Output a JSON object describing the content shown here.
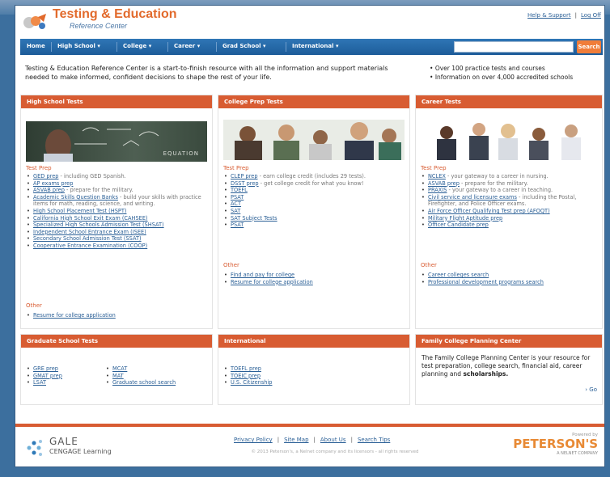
{
  "header": {
    "title": "Testing & Education",
    "subtitle": "Reference Center",
    "help_link": "Help & Support",
    "logoff_link": "Log Off"
  },
  "nav": {
    "items": [
      {
        "label": "Home"
      },
      {
        "label": "High School ▾"
      },
      {
        "label": "College ▾"
      },
      {
        "label": "Career ▾"
      },
      {
        "label": "Grad School ▾"
      },
      {
        "label": "International ▾"
      }
    ],
    "search_value": "",
    "search_button": "Search"
  },
  "intro": {
    "text": "Testing & Education Reference Center is a start-to-finish resource with all the information and support materials needed to make informed, confident decisions to shape the rest of your life.",
    "bullets": [
      "Over 100 practice tests and courses",
      "Information on over 4,000 accredited schools"
    ]
  },
  "panels": {
    "high_school": {
      "title": "High School Tests",
      "image_text": "EQUATION",
      "section1": "Test Prep",
      "items": [
        {
          "link": "GED prep",
          "desc": " - including GED Spanish."
        },
        {
          "link": "AP exams prep",
          "desc": ""
        },
        {
          "link": "ASVAB prep",
          "desc": " - prepare for the military."
        },
        {
          "link": "Academic Skills Question Banks",
          "desc": " - build your skills with practice items for math, reading, science, and writing."
        },
        {
          "link": "High School Placement Test (HSPT)",
          "desc": ""
        },
        {
          "link": "California High School Exit Exam (CAHSEE)",
          "desc": ""
        },
        {
          "link": "Specialized High Schools Admission Test (SHSAT)",
          "desc": ""
        },
        {
          "link": "Independent School Entrance Exam (ISEE)",
          "desc": ""
        },
        {
          "link": "Secondary School Admission Test (SSAT)",
          "desc": ""
        },
        {
          "link": "Cooperative Entrance Examination (COOP)",
          "desc": ""
        }
      ],
      "section2": "Other",
      "other": [
        {
          "link": "Resume for college application"
        }
      ]
    },
    "college": {
      "title": "College Prep Tests",
      "section1": "Test Prep",
      "items": [
        {
          "link": "CLEP prep",
          "desc": " - earn college credit (includes 29 tests)."
        },
        {
          "link": "DSST prep",
          "desc": " - get college credit for what you know!"
        },
        {
          "link": "TOEFL",
          "desc": ""
        },
        {
          "link": "PSAT",
          "desc": ""
        },
        {
          "link": "ACT",
          "desc": ""
        },
        {
          "link": "SAT",
          "desc": ""
        },
        {
          "link": "SAT Subject Tests",
          "desc": ""
        },
        {
          "link": "PSAT",
          "desc": ""
        }
      ],
      "section2": "Other",
      "other": [
        {
          "link": "Find and pay for college"
        },
        {
          "link": "Resume for college application"
        }
      ]
    },
    "career": {
      "title": "Career Tests",
      "section1": "Test Prep",
      "items": [
        {
          "link": "NCLEX",
          "desc": " - your gateway to a career in nursing."
        },
        {
          "link": "ASVAB prep",
          "desc": " - prepare for the military."
        },
        {
          "link": "PRAXIS",
          "desc": " - your gateway to a career in teaching."
        },
        {
          "link": "Civil service and licensure exams",
          "desc": " - including the Postal, Firefighter, and Police Officer exams."
        },
        {
          "link": "Air Force Officer Qualifying Test prep (AFOQT)",
          "desc": ""
        },
        {
          "link": "Military Flight Aptitude prep",
          "desc": ""
        },
        {
          "link": "Officer Candidate prep",
          "desc": ""
        }
      ],
      "section2": "Other",
      "other": [
        {
          "link": "Career colleges search"
        },
        {
          "link": "Professional development programs search"
        }
      ]
    },
    "graduate": {
      "title": "Graduate School Tests",
      "col1": [
        {
          "link": "GRE prep"
        },
        {
          "link": "GMAT prep"
        },
        {
          "link": "LSAT"
        }
      ],
      "col2": [
        {
          "link": "MCAT"
        },
        {
          "link": "MAT"
        },
        {
          "link": "Graduate school search"
        }
      ]
    },
    "international": {
      "title": "International",
      "items": [
        {
          "link": "TOEFL prep"
        },
        {
          "link": "TOEIC prep"
        },
        {
          "link": "U.S. Citizenship"
        }
      ]
    },
    "family": {
      "title": "Family College Planning Center",
      "text": "The Family College Planning Center is your resource for test preparation, college search, financial aid, career planning and",
      "text_bold": "scholarships.",
      "go": "› Go"
    }
  },
  "footer": {
    "gale_title": "GALE",
    "gale_sub": "CENGAGE Learning",
    "links": [
      "Privacy Policy",
      "Site Map",
      "About Us",
      "Search Tips"
    ],
    "copyright": "© 2013 Peterson's, a Nelnet company and its licensors - all rights reserved",
    "powered": "Powered by",
    "petersons": "PETERSON'S",
    "nelnet": "A NELNET COMPANY"
  },
  "colors": {
    "accent": "#d85c32",
    "nav": "#2f76b6",
    "link": "#2a5f96"
  }
}
